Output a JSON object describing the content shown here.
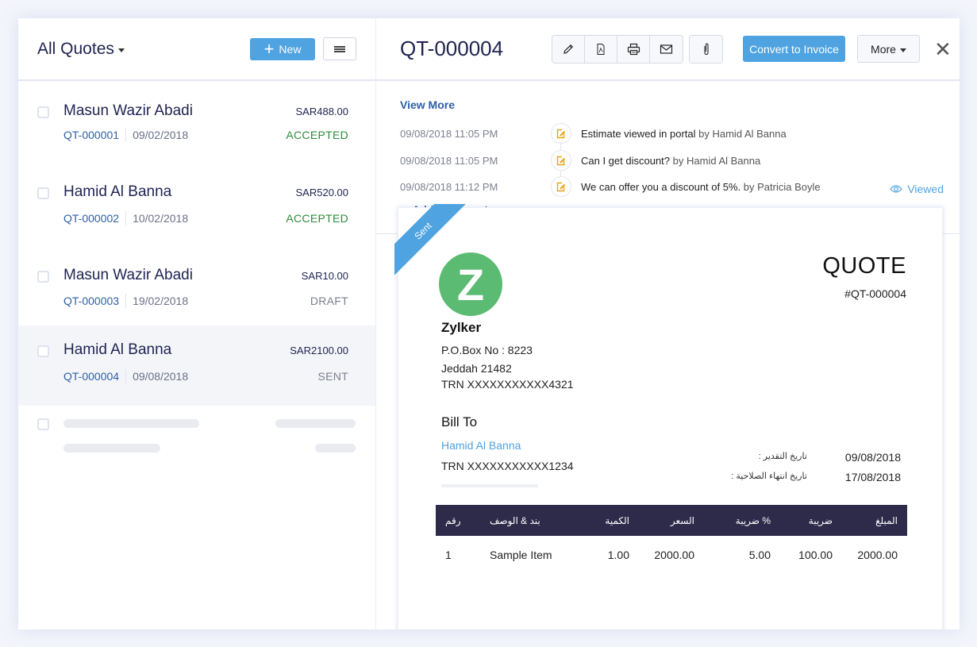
{
  "list": {
    "view_title": "All Quotes",
    "new_label": "New",
    "items": [
      {
        "customer": "Masun Wazir Abadi",
        "amount": "SAR488.00",
        "quote_number": "QT-000001",
        "date": "09/02/2018",
        "status": "ACCEPTED"
      },
      {
        "customer": "Hamid Al Banna",
        "amount": "SAR520.00",
        "quote_number": "QT-000002",
        "date": "10/02/2018",
        "status": "ACCEPTED"
      },
      {
        "customer": "Masun Wazir Abadi",
        "amount": "SAR10.00",
        "quote_number": "QT-000003",
        "date": "19/02/2018",
        "status": "DRAFT"
      },
      {
        "customer": "Hamid Al Banna",
        "amount": "SAR2100.00",
        "quote_number": "QT-000004",
        "date": "09/08/2018",
        "status": "SENT",
        "selected": true
      }
    ]
  },
  "detail": {
    "title": "QT-000004",
    "toolbar": {
      "icons": [
        "pencil-icon",
        "pdf-icon",
        "print-icon",
        "mail-icon",
        "paperclip-icon"
      ],
      "convert_label": "Convert to Invoice",
      "more_label": "More",
      "close_symbol": "✕"
    },
    "activity": {
      "view_more_label": "View More",
      "entries": [
        {
          "timestamp": "09/08/2018  11:05 PM",
          "text": "Estimate viewed in portal",
          "by": "by Hamid Al Banna"
        },
        {
          "timestamp": "09/08/2018  11:05 PM",
          "text": "Can I get discount?",
          "by": "by Hamid Al Banna"
        },
        {
          "timestamp": "09/08/2018  11:12 PM",
          "text": "We can offer you a discount of 5%.",
          "by": "by Patricia Boyle"
        }
      ],
      "add_comment_label": "Add Comment"
    },
    "viewed_label": "Viewed",
    "document": {
      "ribbon": "Sent",
      "logo_letter": "Z",
      "heading": "QUOTE",
      "number": "#QT-000004",
      "org": {
        "name": "Zylker",
        "lines": [
          "P.O.Box No : 8223",
          "Jeddah 21482",
          "TRN XXXXXXXXXXX4321"
        ]
      },
      "bill_to": {
        "label": "Bill To",
        "name": "Hamid Al Banna",
        "trn": "TRN XXXXXXXXXXX1234"
      },
      "dates": [
        {
          "label": "تاريخ التقدير :",
          "value": "09/08/2018"
        },
        {
          "label": "تاريخ انتهاء الصلاحية :",
          "value": "17/08/2018"
        }
      ],
      "table": {
        "headers": [
          "رقم",
          "بند & الوصف",
          "الكمية",
          "السعر",
          "ضريبة %",
          "ضريبة",
          "المبلغ"
        ],
        "rows": [
          [
            "1",
            "Sample Item",
            "1.00",
            "2000.00",
            "5.00",
            "100.00",
            "2000.00"
          ]
        ]
      }
    }
  },
  "colors": {
    "accent": "#4ea3e0",
    "link": "#2d5fa6",
    "accepted": "#2d8a3a",
    "table_header": "#2e2a4a",
    "logo": "#5bbb73",
    "activity_icon": "#e8a317"
  }
}
